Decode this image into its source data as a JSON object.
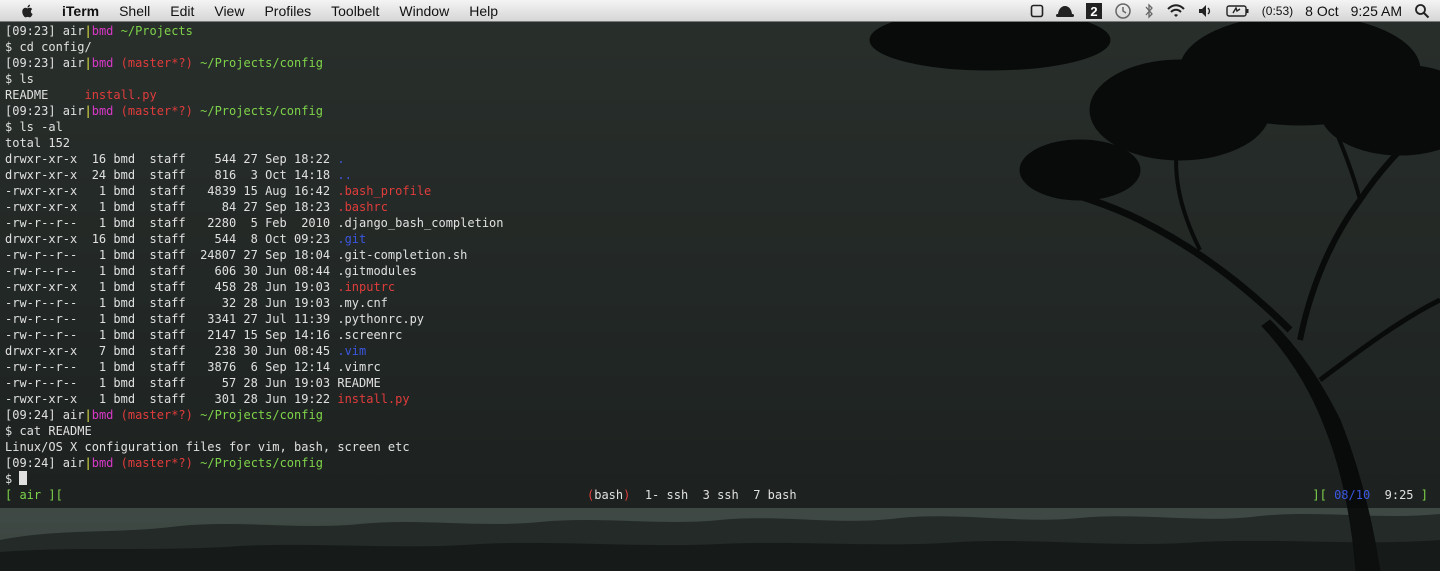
{
  "menubar": {
    "apple_icon": "apple-logo",
    "app_name": "iTerm",
    "items": [
      "Shell",
      "Edit",
      "View",
      "Profiles",
      "Toolbelt",
      "Window",
      "Help"
    ],
    "status_icons": [
      "square-icon",
      "hat-icon",
      "spaces-2-icon",
      "time-machine-icon",
      "bluetooth-icon",
      "wifi-icon",
      "volume-icon",
      "battery-icon"
    ],
    "spaces_number": "2",
    "battery_time": "(0:53)",
    "date": "8 Oct",
    "time": "9:25 AM",
    "spotlight_icon": "search-icon"
  },
  "terminal": {
    "lines": [
      [
        {
          "t": "[09:23] air",
          "c": "w"
        },
        {
          "t": "|",
          "c": "y"
        },
        {
          "t": "bmd",
          "c": "m"
        },
        {
          "t": " ~/Projects",
          "c": "g"
        }
      ],
      [
        {
          "t": "$ cd config/",
          "c": "w"
        }
      ],
      [
        {
          "t": "[09:23] air",
          "c": "w"
        },
        {
          "t": "|",
          "c": "y"
        },
        {
          "t": "bmd",
          "c": "m"
        },
        {
          "t": " (master*?)",
          "c": "r"
        },
        {
          "t": " ~/Projects/config",
          "c": "g"
        }
      ],
      [
        {
          "t": "$ ls",
          "c": "w"
        }
      ],
      [
        {
          "t": "README     ",
          "c": "w"
        },
        {
          "t": "install.py",
          "c": "r"
        }
      ],
      [
        {
          "t": "[09:23] air",
          "c": "w"
        },
        {
          "t": "|",
          "c": "y"
        },
        {
          "t": "bmd",
          "c": "m"
        },
        {
          "t": " (master*?)",
          "c": "r"
        },
        {
          "t": " ~/Projects/config",
          "c": "g"
        }
      ],
      [
        {
          "t": "$ ls -al",
          "c": "w"
        }
      ],
      [
        {
          "t": "total 152",
          "c": "w"
        }
      ],
      [
        {
          "t": "drwxr-xr-x  16 bmd  staff    544 27 Sep 18:22 ",
          "c": "w"
        },
        {
          "t": ".",
          "c": "b"
        }
      ],
      [
        {
          "t": "drwxr-xr-x  24 bmd  staff    816  3 Oct 14:18 ",
          "c": "w"
        },
        {
          "t": "..",
          "c": "b"
        }
      ],
      [
        {
          "t": "-rwxr-xr-x   1 bmd  staff   4839 15 Aug 16:42 ",
          "c": "w"
        },
        {
          "t": ".bash_profile",
          "c": "r"
        }
      ],
      [
        {
          "t": "-rwxr-xr-x   1 bmd  staff     84 27 Sep 18:23 ",
          "c": "w"
        },
        {
          "t": ".bashrc",
          "c": "r"
        }
      ],
      [
        {
          "t": "-rw-r--r--   1 bmd  staff   2280  5 Feb  2010 .django_bash_completion",
          "c": "w"
        }
      ],
      [
        {
          "t": "drwxr-xr-x  16 bmd  staff    544  8 Oct 09:23 ",
          "c": "w"
        },
        {
          "t": ".git",
          "c": "b"
        }
      ],
      [
        {
          "t": "-rw-r--r--   1 bmd  staff  24807 27 Sep 18:04 .git-completion.sh",
          "c": "w"
        }
      ],
      [
        {
          "t": "-rw-r--r--   1 bmd  staff    606 30 Jun 08:44 .gitmodules",
          "c": "w"
        }
      ],
      [
        {
          "t": "-rwxr-xr-x   1 bmd  staff    458 28 Jun 19:03 ",
          "c": "w"
        },
        {
          "t": ".inputrc",
          "c": "r"
        }
      ],
      [
        {
          "t": "-rw-r--r--   1 bmd  staff     32 28 Jun 19:03 .my.cnf",
          "c": "w"
        }
      ],
      [
        {
          "t": "-rw-r--r--   1 bmd  staff   3341 27 Jul 11:39 .pythonrc.py",
          "c": "w"
        }
      ],
      [
        {
          "t": "-rw-r--r--   1 bmd  staff   2147 15 Sep 14:16 .screenrc",
          "c": "w"
        }
      ],
      [
        {
          "t": "drwxr-xr-x   7 bmd  staff    238 30 Jun 08:45 ",
          "c": "w"
        },
        {
          "t": ".vim",
          "c": "b"
        }
      ],
      [
        {
          "t": "-rw-r--r--   1 bmd  staff   3876  6 Sep 12:14 .vimrc",
          "c": "w"
        }
      ],
      [
        {
          "t": "-rw-r--r--   1 bmd  staff     57 28 Jun 19:03 README",
          "c": "w"
        }
      ],
      [
        {
          "t": "-rwxr-xr-x   1 bmd  staff    301 28 Jun 19:22 ",
          "c": "w"
        },
        {
          "t": "install.py",
          "c": "r"
        }
      ],
      [
        {
          "t": "[09:24] air",
          "c": "w"
        },
        {
          "t": "|",
          "c": "y"
        },
        {
          "t": "bmd",
          "c": "m"
        },
        {
          "t": " (master*?)",
          "c": "r"
        },
        {
          "t": " ~/Projects/config",
          "c": "g"
        }
      ],
      [
        {
          "t": "$ cat README",
          "c": "w"
        }
      ],
      [
        {
          "t": "Linux/OS X configuration files for vim, bash, screen etc",
          "c": "w"
        }
      ],
      [
        {
          "t": "[09:24] air",
          "c": "w"
        },
        {
          "t": "|",
          "c": "y"
        },
        {
          "t": "bmd",
          "c": "m"
        },
        {
          "t": " (master*?)",
          "c": "r"
        },
        {
          "t": " ~/Projects/config",
          "c": "g"
        }
      ],
      [
        {
          "t": "$ ",
          "c": "w"
        }
      ]
    ]
  },
  "screen_status": {
    "left": "[ air ][",
    "windows": [
      {
        "t": "(",
        "c": "r"
      },
      {
        "t": "bash",
        "c": "w"
      },
      {
        "t": ")",
        "c": "r"
      },
      {
        "t": "  1- ssh  3 ssh  7 bash",
        "c": "w"
      }
    ],
    "right": [
      {
        "t": "][ ",
        "c": "g"
      },
      {
        "t": "08/10",
        "c": "b"
      },
      {
        "t": "  9:25 ",
        "c": "w"
      },
      {
        "t": "]",
        "c": "g"
      }
    ]
  },
  "colors": {
    "white": "#e0e0e0",
    "yellow": "#e6e64a",
    "magenta": "#d838c8",
    "red": "#e03c3c",
    "green": "#7fd34a",
    "blue": "#3a56e0"
  }
}
